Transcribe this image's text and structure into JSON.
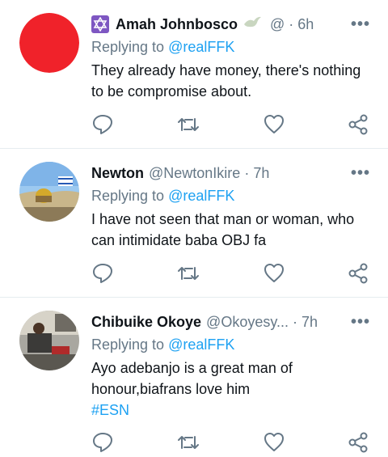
{
  "tweets": [
    {
      "name": "Amah Johnbosco",
      "handle": "@",
      "separator": "·",
      "time": "6h",
      "replying_label": "Replying to",
      "replying_to": "@realFFK",
      "body": "They already have money, there's nothing to be compromise about.",
      "hashtag": "",
      "avatar": "red-circle-avatar"
    },
    {
      "name": "Newton",
      "handle": "@NewtonIkire",
      "separator": "·",
      "time": "7h",
      "replying_label": "Replying to",
      "replying_to": "@realFFK",
      "body": "I have not seen that man or woman, who can intimidate baba OBJ fa",
      "hashtag": "",
      "avatar": "jerusalem-photo-avatar"
    },
    {
      "name": "Chibuike Okoye",
      "handle": "@Okoyesy...",
      "separator": "·",
      "time": "7h",
      "replying_label": "Replying to",
      "replying_to": "@realFFK",
      "body": "Ayo adebanjo is a great man of honour,biafrans love him",
      "hashtag": "#ESN",
      "avatar": "office-photo-avatar"
    }
  ],
  "more_label": "•••",
  "icons": [
    "reply-icon",
    "retweet-icon",
    "like-icon",
    "share-icon",
    "star-of-david-icon",
    "dove-icon"
  ],
  "colors": {
    "accent": "#1da1f2",
    "muted": "#657786",
    "avatar_red": "#f0222a",
    "badge": "#7e57c2"
  }
}
